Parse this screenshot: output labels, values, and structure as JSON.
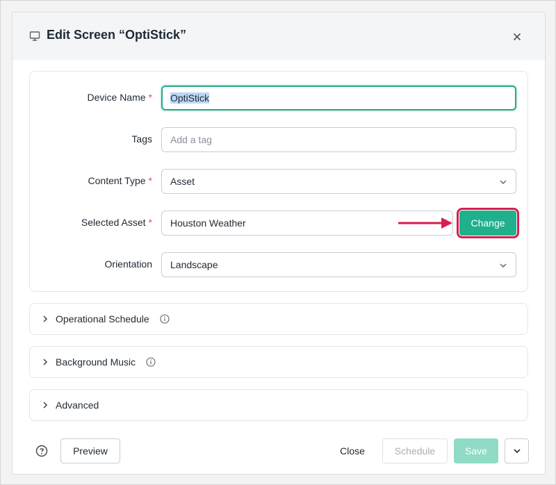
{
  "modal": {
    "title": "Edit Screen  “OptiStick”"
  },
  "form": {
    "device_name": {
      "label": "Device Name",
      "required": "*",
      "value": "OptiStick"
    },
    "tags": {
      "label": "Tags",
      "placeholder": "Add a tag"
    },
    "content_type": {
      "label": "Content Type",
      "required": "*",
      "value": "Asset"
    },
    "selected_asset": {
      "label": "Selected Asset",
      "required": "*",
      "value": "Houston Weather",
      "change_label": "Change"
    },
    "orientation": {
      "label": "Orientation",
      "value": "Landscape"
    }
  },
  "sections": [
    {
      "label": "Operational Schedule",
      "has_info": true
    },
    {
      "label": "Background Music",
      "has_info": true
    },
    {
      "label": "Advanced",
      "has_info": false
    }
  ],
  "footer": {
    "preview_label": "Preview",
    "close_label": "Close",
    "schedule_label": "Schedule",
    "save_label": "Save"
  },
  "icons": {
    "title_icon": "monitor-icon",
    "close": "close-icon",
    "help": "help-circle-icon",
    "more": "chevron-down-icon",
    "section_toggle": "chevron-right-icon",
    "info": "info-icon"
  },
  "colors": {
    "accent": "#20b08c",
    "accent_disabled": "#8fdbc6",
    "highlight": "#d81e4f",
    "required": "#e5484d"
  }
}
